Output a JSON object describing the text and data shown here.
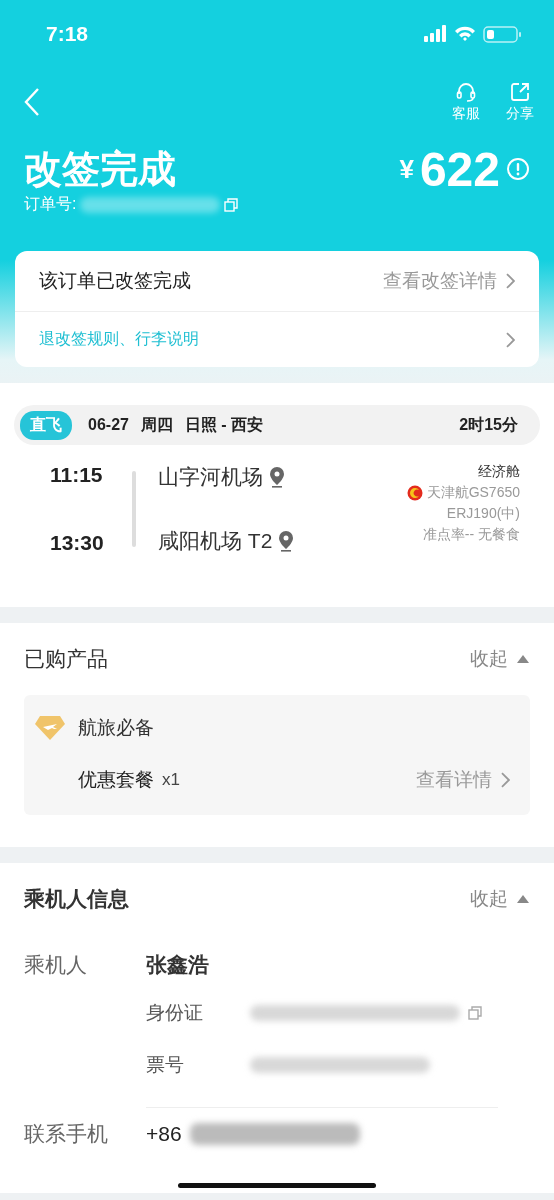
{
  "status_bar": {
    "time": "7:18"
  },
  "nav": {
    "actions": [
      {
        "kind": "headset",
        "label": "客服"
      },
      {
        "kind": "share",
        "label": "分享"
      }
    ]
  },
  "header": {
    "title": "改签完成",
    "order_label": "订单号:",
    "currency": "¥",
    "price": "622"
  },
  "status_card": {
    "rows": [
      {
        "kind": "status",
        "label": "该订单已改签完成",
        "link": "查看改签详情"
      },
      {
        "kind": "rules",
        "label": "退改签规则、行李说明"
      }
    ]
  },
  "flight": {
    "tag": "直飞",
    "date": "06-27",
    "weekday": "周四",
    "route": "日照 - 西安",
    "duration": "2时15分",
    "departure": {
      "time": "11:15",
      "airport": "山字河机场"
    },
    "arrival": {
      "time": "13:30",
      "airport": "咸阳机场 T2"
    },
    "cabin": "经济舱",
    "airline": "天津航GS7650",
    "aircraft": "ERJ190(中)",
    "extra": "准点率-- 无餐食"
  },
  "products": {
    "title": "已购产品",
    "toggle": "收起",
    "expanded": true,
    "group": "航旅必备",
    "item": "优惠套餐",
    "quantity": "x1",
    "link": "查看详情"
  },
  "passengers": {
    "title": "乘机人信息",
    "toggle": "收起",
    "expanded": true,
    "label": "乘机人",
    "name": "张鑫浩",
    "fields": [
      {
        "label": "身份证",
        "copyable": true
      },
      {
        "label": "票号",
        "copyable": false
      }
    ],
    "phone_label": "联系手机",
    "phone_prefix": "+86"
  }
}
